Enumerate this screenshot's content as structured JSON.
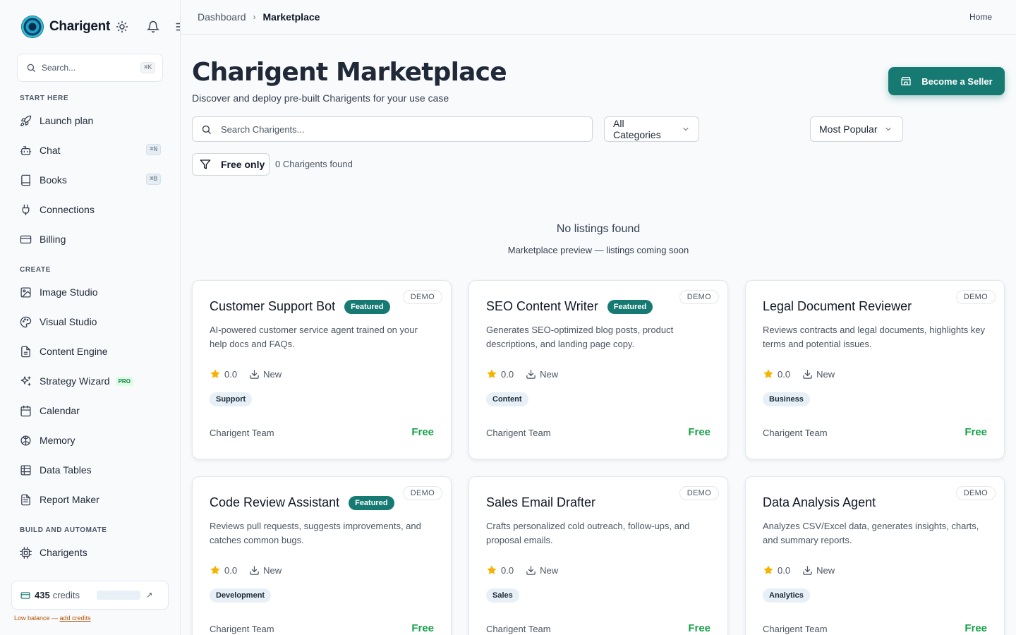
{
  "brand": {
    "name": "Charigent"
  },
  "sidebar": {
    "search_placeholder": "Search...",
    "search_shortcut": "⌘K",
    "sections": {
      "start": "START HERE",
      "create": "CREATE",
      "build": "BUILD AND AUTOMATE"
    },
    "items": [
      {
        "label": "Launch plan",
        "icon": "rocket-icon"
      },
      {
        "label": "Chat",
        "icon": "bot-icon",
        "shortcut": "⌘N"
      },
      {
        "label": "Books",
        "icon": "book-icon",
        "shortcut": "⌘B"
      },
      {
        "label": "Connections",
        "icon": "plug-icon"
      },
      {
        "label": "Billing",
        "icon": "credit-card-icon"
      },
      {
        "label": "Image Studio",
        "icon": "image-icon"
      },
      {
        "label": "Visual Studio",
        "icon": "palette-icon"
      },
      {
        "label": "Content Engine",
        "icon": "file-text-icon"
      },
      {
        "label": "Strategy Wizard",
        "icon": "sparkles-icon",
        "badge": "PRO"
      },
      {
        "label": "Calendar",
        "icon": "calendar-icon"
      },
      {
        "label": "Memory",
        "icon": "brain-icon"
      },
      {
        "label": "Data Tables",
        "icon": "table-icon"
      },
      {
        "label": "Report Maker",
        "icon": "clipboard-icon"
      },
      {
        "label": "Charigents",
        "icon": "cpu-icon"
      }
    ],
    "credits": {
      "amount": "435",
      "unit": "credits",
      "arrow": "↗"
    },
    "low_balance": {
      "text": "Low balance — ",
      "link": "add credits"
    }
  },
  "header": {
    "breadcrumb": [
      "Dashboard",
      "Marketplace"
    ],
    "home": "Home"
  },
  "main": {
    "title": "Charigent Marketplace",
    "subtitle": "Discover and deploy pre-built Charigents for your use case",
    "become_seller": "Become a Seller",
    "search_placeholder": "Search Charigents...",
    "category": "All Categories",
    "sort": "Most Popular",
    "free_only": "Free only",
    "found": "0 Charigents found",
    "empty_title": "No listings found",
    "empty_sub": "Marketplace preview — listings coming soon"
  },
  "cards": [
    {
      "title": "Customer Support Bot",
      "featured": "Featured",
      "demo": "DEMO",
      "desc": "AI-powered customer service agent trained on your help docs and FAQs.",
      "rating": "0.0",
      "installs": "New",
      "tag": "Support",
      "author": "Charigent Team",
      "price": "Free"
    },
    {
      "title": "SEO Content Writer",
      "featured": "Featured",
      "demo": "DEMO",
      "desc": "Generates SEO-optimized blog posts, product descriptions, and landing page copy.",
      "rating": "0.0",
      "installs": "New",
      "tag": "Content",
      "author": "Charigent Team",
      "price": "Free"
    },
    {
      "title": "Legal Document Reviewer",
      "featured": "",
      "demo": "DEMO",
      "desc": "Reviews contracts and legal documents, highlights key terms and potential issues.",
      "rating": "0.0",
      "installs": "New",
      "tag": "Business",
      "author": "Charigent Team",
      "price": "Free"
    },
    {
      "title": "Code Review Assistant",
      "featured": "Featured",
      "demo": "DEMO",
      "desc": "Reviews pull requests, suggests improvements, and catches common bugs.",
      "rating": "0.0",
      "installs": "New",
      "tag": "Development",
      "author": "Charigent Team",
      "price": "Free"
    },
    {
      "title": "Sales Email Drafter",
      "featured": "",
      "demo": "DEMO",
      "desc": "Crafts personalized cold outreach, follow-ups, and proposal emails.",
      "rating": "0.0",
      "installs": "New",
      "tag": "Sales",
      "author": "Charigent Team",
      "price": "Free"
    },
    {
      "title": "Data Analysis Agent",
      "featured": "",
      "demo": "DEMO",
      "desc": "Analyzes CSV/Excel data, generates insights, charts, and summary reports.",
      "rating": "0.0",
      "installs": "New",
      "tag": "Analytics",
      "author": "Charigent Team",
      "price": "Free"
    }
  ],
  "colors": {
    "accent": "#167a73",
    "price": "#16a34a",
    "star": "#f5b301",
    "warning": "#b45309"
  }
}
